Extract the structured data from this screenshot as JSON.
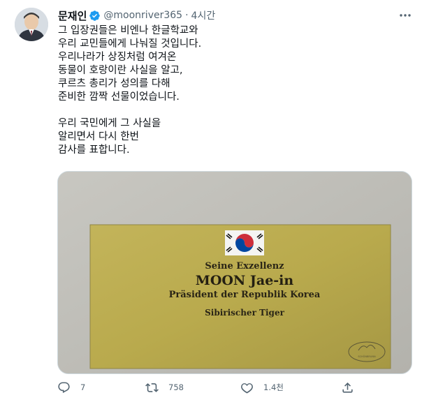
{
  "tweet": {
    "author_name": "문재인",
    "handle": "@moonriver365",
    "separator": "·",
    "time": "4시간",
    "text_lines": [
      "그 입장권들은 비엔나 한글학교와",
      "우리 교민들에게 나눠질 것입니다.",
      "우리나라가 상징처럼 여겨온",
      "동물이 호랑이란 사실을 알고,",
      "쿠르츠 총리가 성의를 다해",
      "준비한 깜짝 선물이었습니다.",
      "",
      "우리 국민에게 그 사실을",
      "알리면서 다시 한번",
      "감사를 표합니다."
    ],
    "media": {
      "line1": "Seine Exzellenz",
      "line2": "MOON Jae-in",
      "line3": "Präsident der Republik Korea",
      "line4": "Sibirischer Tiger",
      "stamp_text": "SCHÖNBRUNN"
    },
    "actions": {
      "reply_count": "7",
      "retweet_count": "758",
      "like_count": "1.4천"
    },
    "colors": {
      "verified_blue": "#1d9bf0",
      "meta_gray": "#536471",
      "card_gold": "#bba84a"
    }
  }
}
